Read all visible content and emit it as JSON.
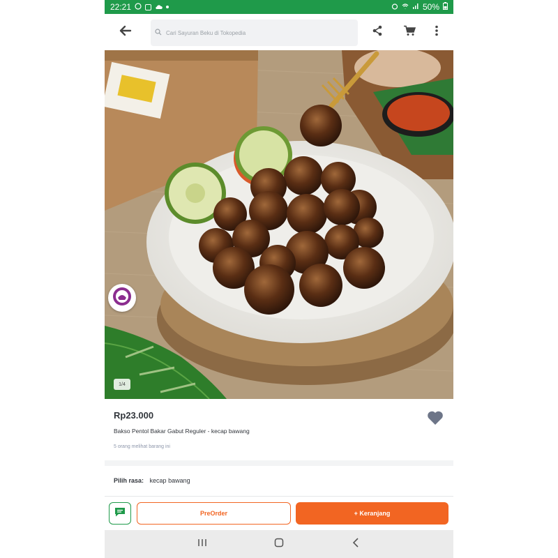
{
  "status_bar": {
    "time": "22:21",
    "battery": "50%",
    "left_icons": [
      "whatsapp-icon",
      "gallery-icon",
      "cloud-icon",
      "dot-icon"
    ],
    "right_icons": [
      "alarm-icon",
      "wifi-icon",
      "signal-icon",
      "battery-icon"
    ]
  },
  "header": {
    "search_placeholder": "Cari Sayuran Beku di Tokopedia",
    "icons": [
      "back-arrow-icon",
      "search-icon",
      "share-icon",
      "cart-icon",
      "more-vert-icon"
    ]
  },
  "gallery": {
    "counter": "1/4"
  },
  "product": {
    "price": "Rp23.000",
    "name": "Bakso Pentol Bakar Gabut Reguler - kecap bawang",
    "seen_text": "5 orang melihat barang ini"
  },
  "variant": {
    "label": "Pilih rasa:",
    "value": "kecap bawang"
  },
  "actions": {
    "preorder_label": "PreOrder",
    "cart_label": "+ Keranjang"
  },
  "colors": {
    "status_bar": "#1f9a4a",
    "accent_orange": "#f26522",
    "chat_green": "#1f9a4a",
    "text_dark": "#31353b"
  }
}
